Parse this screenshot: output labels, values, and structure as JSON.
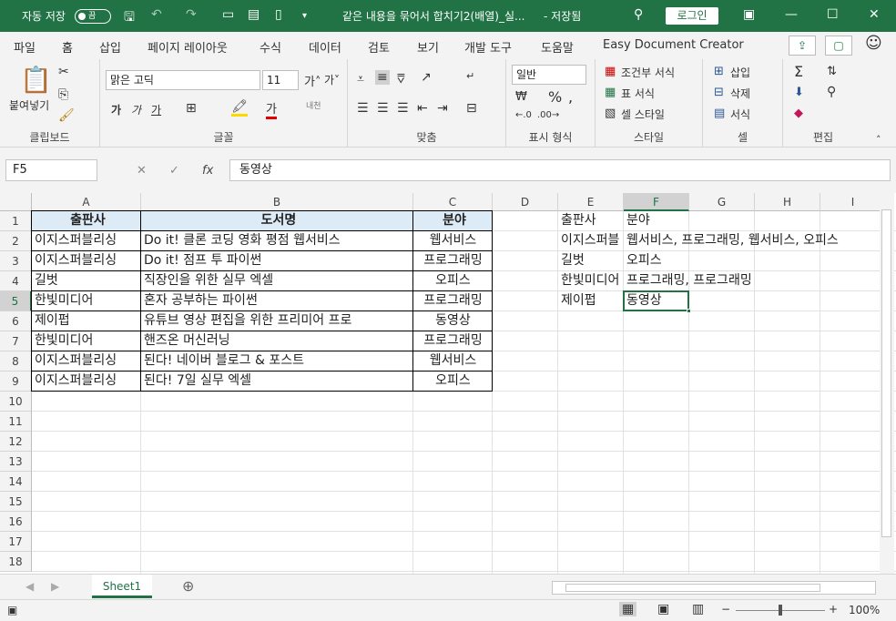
{
  "titlebar": {
    "autosave_label": "자동 저장",
    "toggle_state": "끔",
    "title": "같은 내용을 묶어서 합치기2(배열)_실...",
    "save_status": "- 저장됨",
    "login": "로그인"
  },
  "menu": {
    "items": [
      "파일",
      "홈",
      "삽입",
      "페이지 레이아웃",
      "수식",
      "데이터",
      "검토",
      "보기",
      "개발 도구",
      "도움말",
      "Easy Document Creator"
    ],
    "active": "홈"
  },
  "ribbon": {
    "clipboard": {
      "paste": "붙여넣기",
      "label": "클립보드"
    },
    "font": {
      "name": "맑은 고딕",
      "size": "11",
      "label": "글꼴",
      "bold": "가",
      "italic": "가",
      "underline": "가",
      "phonetic": "내천"
    },
    "align": {
      "label": "맞춤"
    },
    "number": {
      "format": "일반",
      "label": "표시 형식"
    },
    "styles": {
      "conditional": "조건부 서식",
      "table": "표 서식",
      "cell": "셀 스타일",
      "label": "스타일"
    },
    "cells": {
      "insert": "삽입",
      "delete": "삭제",
      "format": "서식",
      "label": "셀"
    },
    "edit": {
      "label": "편집"
    }
  },
  "formula": {
    "namebox": "F5",
    "content": "동영상"
  },
  "sheet": {
    "columns": [
      "A",
      "B",
      "C",
      "D",
      "E",
      "F",
      "G",
      "H",
      "I"
    ],
    "rows": [
      "1",
      "2",
      "3",
      "4",
      "5",
      "6",
      "7",
      "8",
      "9",
      "10",
      "11",
      "12",
      "13",
      "14",
      "15",
      "16",
      "17",
      "18"
    ],
    "table_header": [
      "출판사",
      "도서명",
      "분야"
    ],
    "table_rows": [
      [
        "이지스퍼블리싱",
        "Do it! 클론 코딩 영화 평점 웹서비스",
        "웹서비스"
      ],
      [
        "이지스퍼블리싱",
        "Do it! 점프 투 파이썬",
        "프로그래밍"
      ],
      [
        "길벗",
        "직장인을 위한 실무 엑셀",
        "오피스"
      ],
      [
        "한빛미디어",
        "혼자 공부하는 파이썬",
        "프로그래밍"
      ],
      [
        "제이펍",
        "유튜브 영상 편집을 위한 프리미어 프로",
        "동영상"
      ],
      [
        "한빛미디어",
        "핸즈온 머신러닝",
        "프로그래밍"
      ],
      [
        "이지스퍼블리싱",
        "된다! 네이버 블로그 & 포스트",
        "웹서비스"
      ],
      [
        "이지스퍼블리싱",
        "된다! 7일 실무 엑셀",
        "오피스"
      ]
    ],
    "summary_header": [
      "출판사",
      "분야"
    ],
    "summary_rows": [
      [
        "이지스퍼블",
        "웹서비스, 프로그래밍, 웹서비스, 오피스"
      ],
      [
        "길벗",
        "오피스"
      ],
      [
        "한빛미디어",
        "프로그래밍, 프로그래밍"
      ],
      [
        "제이펍",
        "동영상"
      ]
    ]
  },
  "tabs": {
    "sheet": "Sheet1"
  },
  "status": {
    "zoom": "100%"
  },
  "colors": {
    "accent": "#217346",
    "header_fill": "#ddebf7"
  }
}
